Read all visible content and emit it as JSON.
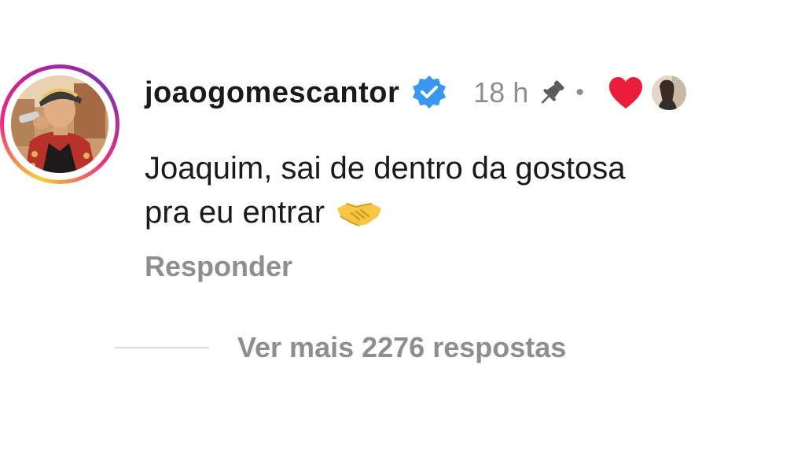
{
  "comment": {
    "author": {
      "username": "joaogomescantor",
      "avatar_icon": "singer-avatar",
      "verified_icon": "verified-badge-icon",
      "story_ring": true
    },
    "time": "18 h",
    "pin_icon": "pin-icon",
    "separator": "•",
    "like": {
      "icon": "heart-icon",
      "color": "#ed1c3a",
      "liked_by_avatar": "liker-avatar"
    },
    "text_lines": [
      "Joaquim, sai de dentro da gostosa",
      "pra eu entrar"
    ],
    "emoji": "handshake-emoji",
    "reply_label": "Responder"
  },
  "replies": {
    "view_more_label": "Ver mais 2276 respostas"
  },
  "colors": {
    "text_primary": "#1a1a1a",
    "text_secondary": "#8e8e8e",
    "verified_blue": "#3897f0",
    "divider": "#dbdbdb"
  }
}
